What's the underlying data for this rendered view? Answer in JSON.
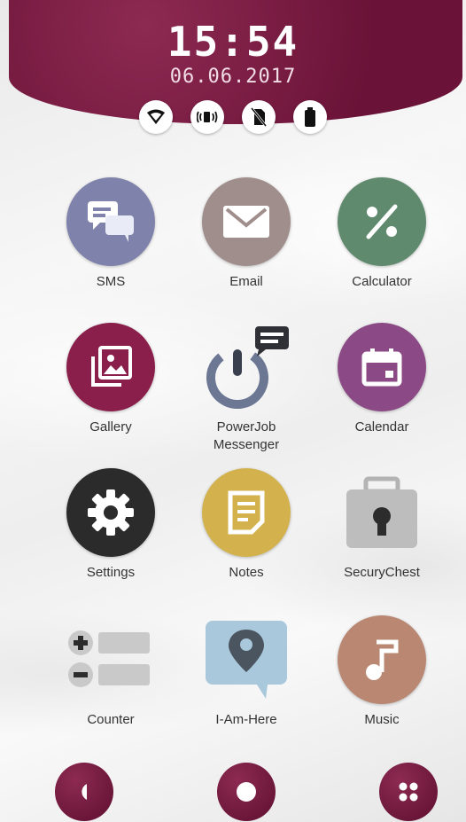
{
  "status_bar": {
    "time": "15:54",
    "date": "06.06.2017",
    "icons": [
      "wifi-icon",
      "volume-icon",
      "no-sim-icon",
      "battery-icon"
    ]
  },
  "apps": [
    {
      "label": "SMS",
      "icon": "sms-icon",
      "color": "#7f83ab"
    },
    {
      "label": "Email",
      "icon": "email-icon",
      "color": "#a08e8c"
    },
    {
      "label": "Calculator",
      "icon": "calculator-icon",
      "color": "#5f8a6e"
    },
    {
      "label": "Gallery",
      "icon": "gallery-icon",
      "color": "#8a1f4c"
    },
    {
      "label": "PowerJob\nMessenger",
      "icon": "power-message-icon",
      "color": "#6c7893"
    },
    {
      "label": "Calendar",
      "icon": "calendar-icon",
      "color": "#8b4a86"
    },
    {
      "label": "Settings",
      "icon": "gear-icon",
      "color": "#2b2b2b"
    },
    {
      "label": "Notes",
      "icon": "notes-icon",
      "color": "#d3b24e"
    },
    {
      "label": "SecuryChest",
      "icon": "lock-chest-icon",
      "color": "#b9b9b9"
    },
    {
      "label": "Counter",
      "icon": "counter-icon",
      "color": "#bcbcbc"
    },
    {
      "label": "I-Am-Here",
      "icon": "map-pin-icon",
      "color": "#a9c8db"
    },
    {
      "label": "Music",
      "icon": "music-icon",
      "color": "#b98772"
    }
  ],
  "dock": [
    "half-moon-icon",
    "home-circle-icon",
    "app-grid-icon"
  ],
  "colors": {
    "accent": "#7a1a44",
    "label_text": "#333333"
  }
}
